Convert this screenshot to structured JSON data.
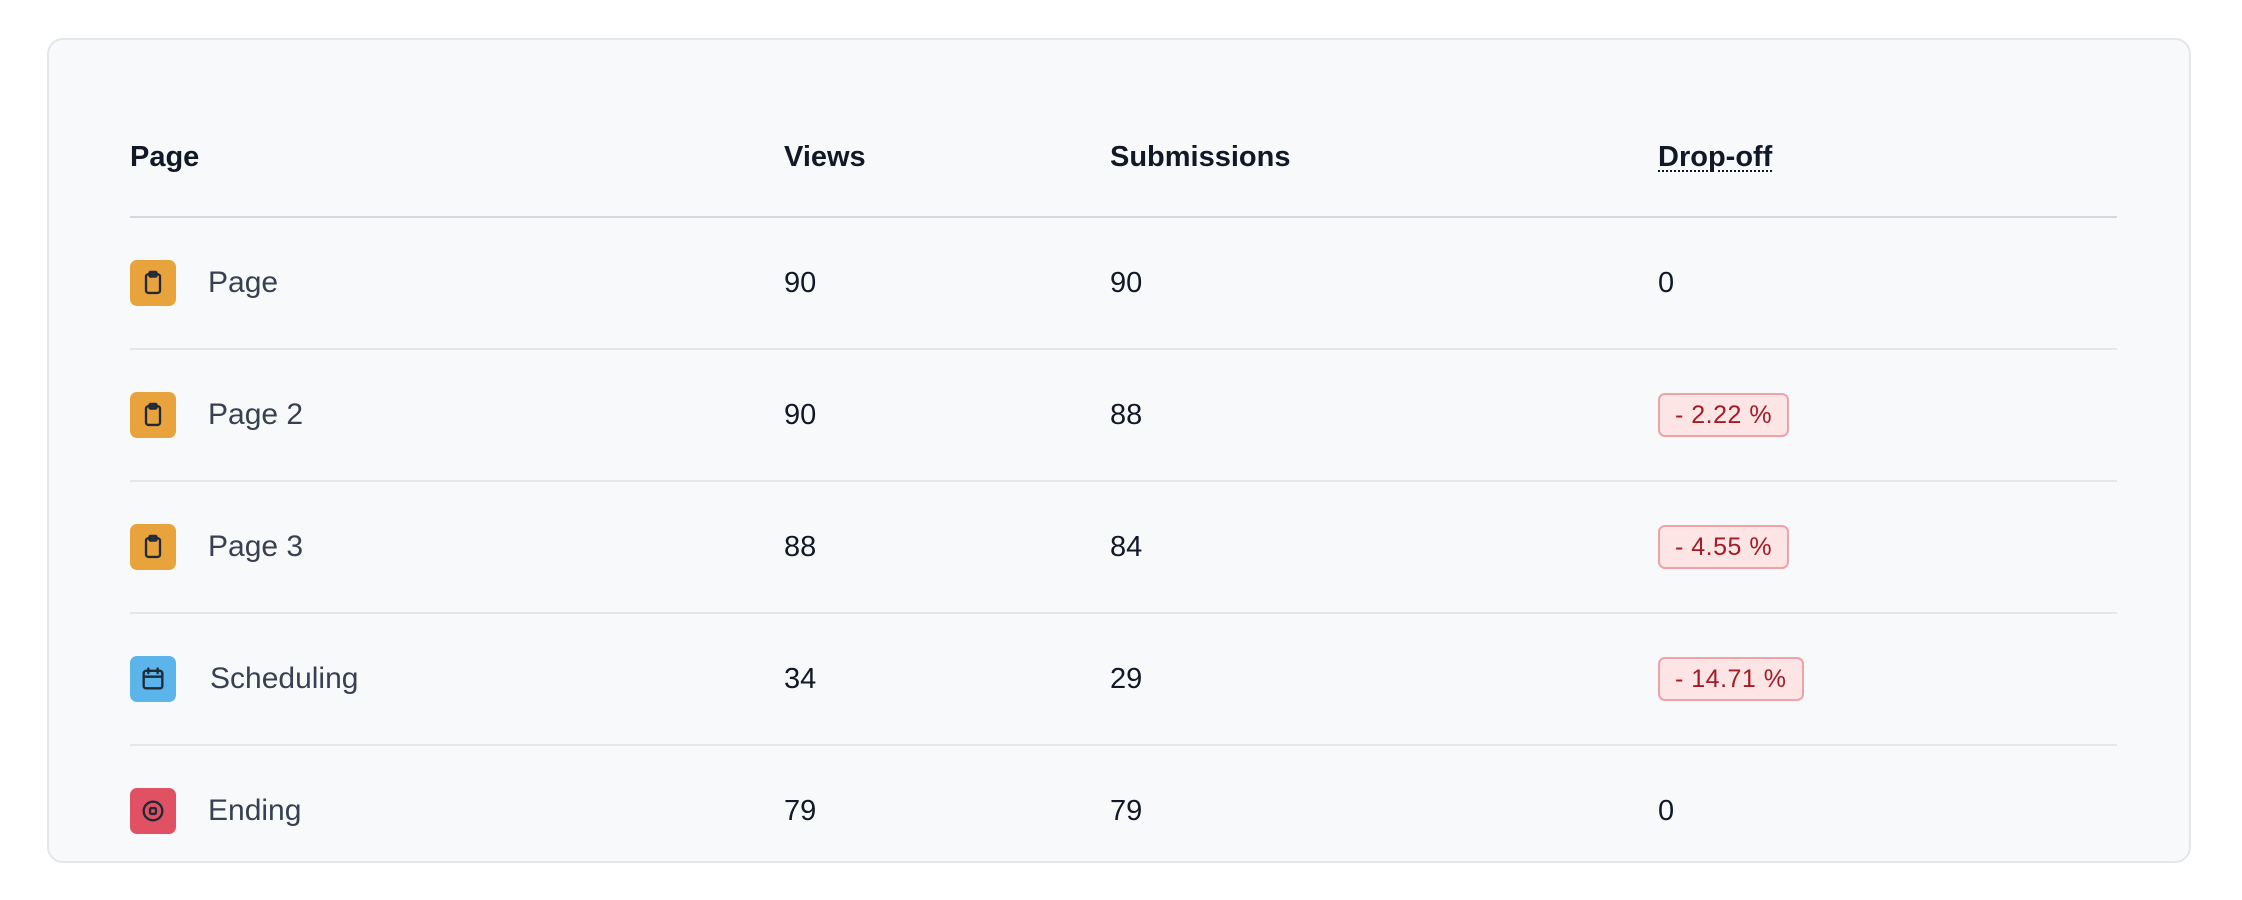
{
  "table": {
    "headers": {
      "page": "Page",
      "views": "Views",
      "submissions": "Submissions",
      "dropoff": "Drop-off"
    },
    "rows": [
      {
        "name": "Page",
        "icon": "clipboard-icon",
        "color": "#e8a33c",
        "views": "90",
        "submissions": "90",
        "dropoff": "0",
        "dropoff_badge": false
      },
      {
        "name": "Page 2",
        "icon": "clipboard-icon",
        "color": "#e8a33c",
        "views": "90",
        "submissions": "88",
        "dropoff": "- 2.22 %",
        "dropoff_badge": true
      },
      {
        "name": "Page 3",
        "icon": "clipboard-icon",
        "color": "#e8a33c",
        "views": "88",
        "submissions": "84",
        "dropoff": "- 4.55 %",
        "dropoff_badge": true
      },
      {
        "name": "Scheduling",
        "icon": "calendar-icon",
        "color": "#5bb4ea",
        "views": "34",
        "submissions": "29",
        "dropoff": "- 14.71 %",
        "dropoff_badge": true
      },
      {
        "name": "Ending",
        "icon": "stop-circle-icon",
        "color": "#e05163",
        "views": "79",
        "submissions": "79",
        "dropoff": "0",
        "dropoff_badge": false
      }
    ]
  },
  "colors": {
    "badge_text": "#a21c25",
    "badge_bg": "#fde4e5",
    "badge_border": "#f0a2a6"
  }
}
